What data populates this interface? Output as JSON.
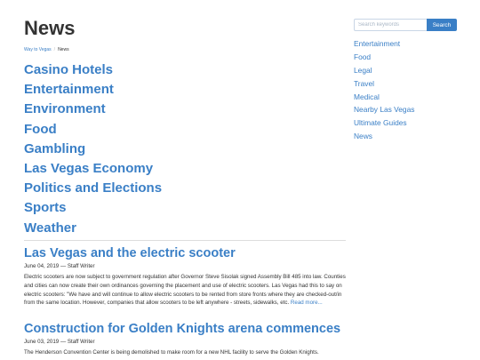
{
  "page": {
    "title": "News"
  },
  "breadcrumb": {
    "home": "Way to Vegas",
    "current": "News"
  },
  "categories": [
    {
      "label": "Casino Hotels"
    },
    {
      "label": "Entertainment"
    },
    {
      "label": "Environment"
    },
    {
      "label": "Food"
    },
    {
      "label": "Gambling"
    },
    {
      "label": "Las Vegas Economy"
    },
    {
      "label": "Politics and Elections"
    },
    {
      "label": "Sports"
    },
    {
      "label": "Weather"
    }
  ],
  "articles": [
    {
      "title": "Las Vegas and the electric scooter",
      "meta": "June 04, 2019 — Staff Writer",
      "excerpt": "Electric scooters are now subject to government regulation after Governor Steve Sisolak signed Assembly Bill 485 into law. Counties and cities can now create their own ordinances governing the placement and use of electric scooters. Las Vegas had this to say on electric scooters: \"We have and will continue to allow electric scooters to be rented from store fronts where they are checked-out/in from the same location. However, companies that allow scooters to be left anywhere - streets, sidewalks, etc.",
      "read_more": "Read more..."
    },
    {
      "title": "Construction for Golden Knights arena commences",
      "meta": "June 03, 2019 — Staff Writer",
      "excerpt": "The Henderson Convention Center is being demolished to make room for a new NHL facility to serve the Golden Knights.",
      "read_more": ""
    }
  ],
  "sidebar": {
    "search_placeholder": "Search keywords",
    "search_button": "Search",
    "links": [
      {
        "label": "Entertainment"
      },
      {
        "label": "Food"
      },
      {
        "label": "Legal"
      },
      {
        "label": "Travel"
      },
      {
        "label": "Medical"
      },
      {
        "label": "Nearby Las Vegas"
      },
      {
        "label": "Ultimate Guides"
      },
      {
        "label": "News"
      }
    ]
  }
}
